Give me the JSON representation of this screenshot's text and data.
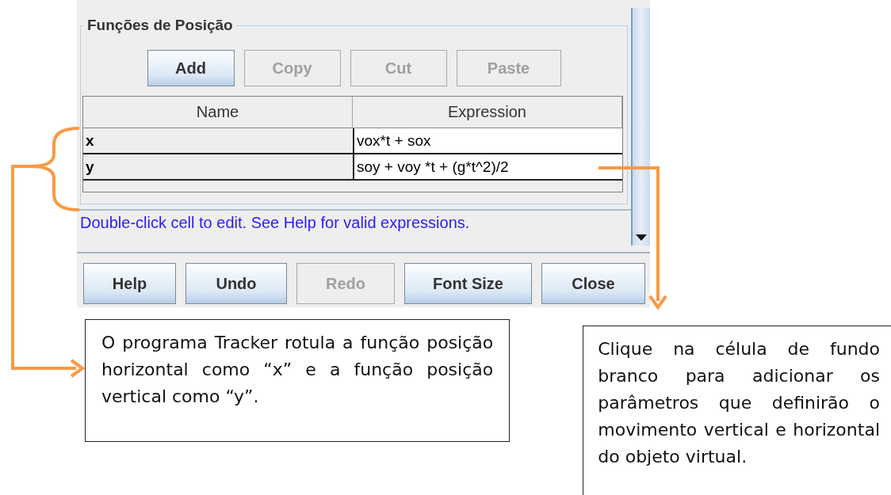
{
  "group": {
    "title": "Funções de Posição",
    "buttons": [
      {
        "label": "Add",
        "disabled": false
      },
      {
        "label": "Copy",
        "disabled": true
      },
      {
        "label": "Cut",
        "disabled": true
      },
      {
        "label": "Paste",
        "disabled": true
      }
    ]
  },
  "table": {
    "columns": [
      "Name",
      "Expression"
    ],
    "rows": [
      {
        "name": "x",
        "expression": "vox*t + sox"
      },
      {
        "name": "y",
        "expression": "soy + voy *t + (g*t^2)/2"
      }
    ]
  },
  "hint": "Double-click cell to edit. See Help for valid expressions.",
  "buttons": [
    {
      "label": "Help",
      "disabled": false
    },
    {
      "label": "Undo",
      "disabled": false
    },
    {
      "label": "Redo",
      "disabled": true
    },
    {
      "label": "Font Size",
      "disabled": false
    },
    {
      "label": "Close",
      "disabled": false
    }
  ],
  "callouts": [
    {
      "text": "O programa Tracker rotula a função posição horizontal como “x” e a função posição vertical como “y”."
    },
    {
      "text": "Clique na célula de fundo branco para adicionar os parâmetros que definirão o movimento vertical e horizontal do objeto virtual."
    }
  ]
}
